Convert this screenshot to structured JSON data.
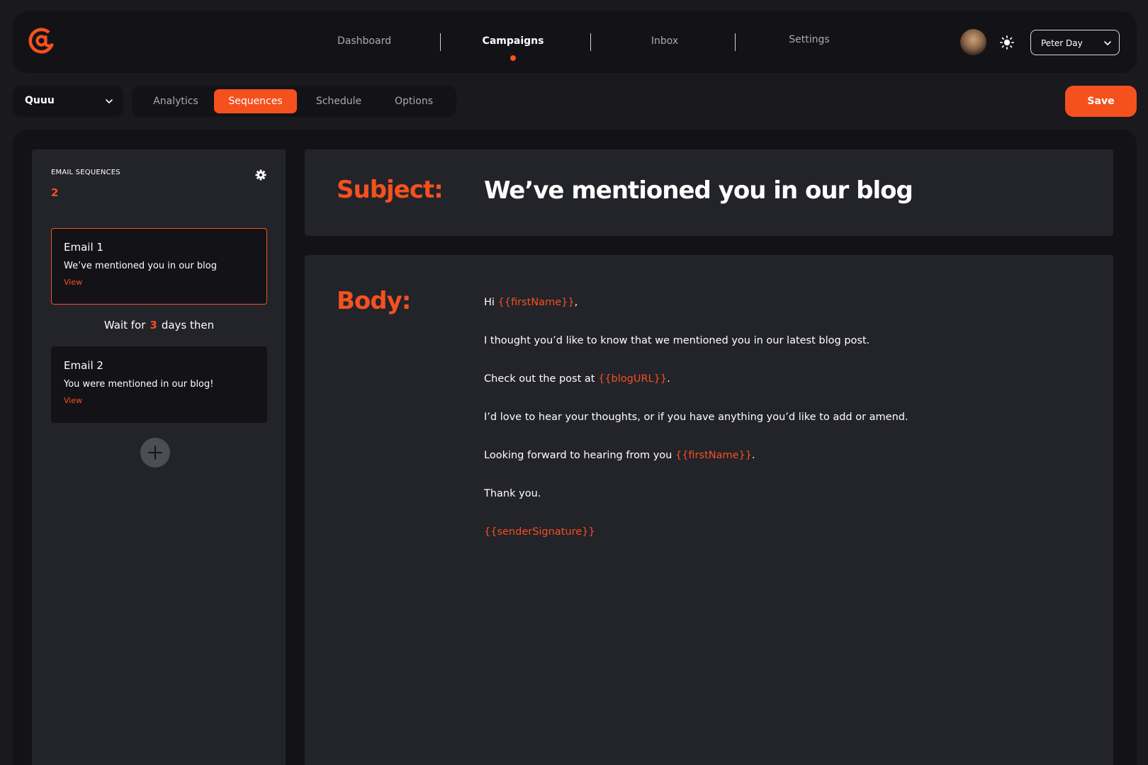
{
  "colors": {
    "accent": "#f4511e",
    "background": "#19191e",
    "panel_dark": "#131317",
    "panel": "#23232a"
  },
  "topbar": {
    "logo_icon": "at-sign-icon",
    "nav": [
      {
        "label": "Dashboard"
      },
      {
        "label": "Campaigns",
        "active": true
      },
      {
        "label": "Inbox"
      },
      {
        "label": "Settings"
      }
    ],
    "theme_icon": "sun-icon",
    "user_name": "Peter Day"
  },
  "toolbar": {
    "campaign_name": "Quuu",
    "tabs": [
      {
        "label": "Analytics"
      },
      {
        "label": "Sequences",
        "active": true
      },
      {
        "label": "Schedule"
      },
      {
        "label": "Options"
      }
    ],
    "save_label": "Save"
  },
  "sequences": {
    "title": "EMAIL SEQUENCES",
    "count": "2",
    "emails": [
      {
        "name": "Email 1",
        "subject": "We’ve mentioned you in our blog",
        "view_label": "View",
        "selected": true
      },
      {
        "name": "Email 2",
        "subject": "You were mentioned in our blog!",
        "view_label": "View",
        "selected": false
      }
    ],
    "wait": {
      "prefix": "Wait for",
      "days": "3",
      "suffix": "days then"
    }
  },
  "editor": {
    "subject_label": "Subject:",
    "subject_value": "We’ve mentioned you in our blog",
    "body_label": "Body:",
    "body_lines": [
      {
        "before": "Hi ",
        "var": "{{firstName}}",
        "after": ","
      },
      {
        "before": "I thought you’d like to know that we mentioned you in our latest blog post.",
        "var": "",
        "after": ""
      },
      {
        "before": "Check out the post at ",
        "var": "{{blogURL}}",
        "after": "."
      },
      {
        "before": "I’d love to hear your thoughts, or if you have anything you’d like to add or amend.",
        "var": "",
        "after": ""
      },
      {
        "before": "Looking forward to hearing from you ",
        "var": "{{firstName}}",
        "after": "."
      },
      {
        "before": "Thank you.",
        "var": "",
        "after": ""
      },
      {
        "before": "",
        "var": "{{senderSignature}}",
        "after": ""
      }
    ]
  }
}
